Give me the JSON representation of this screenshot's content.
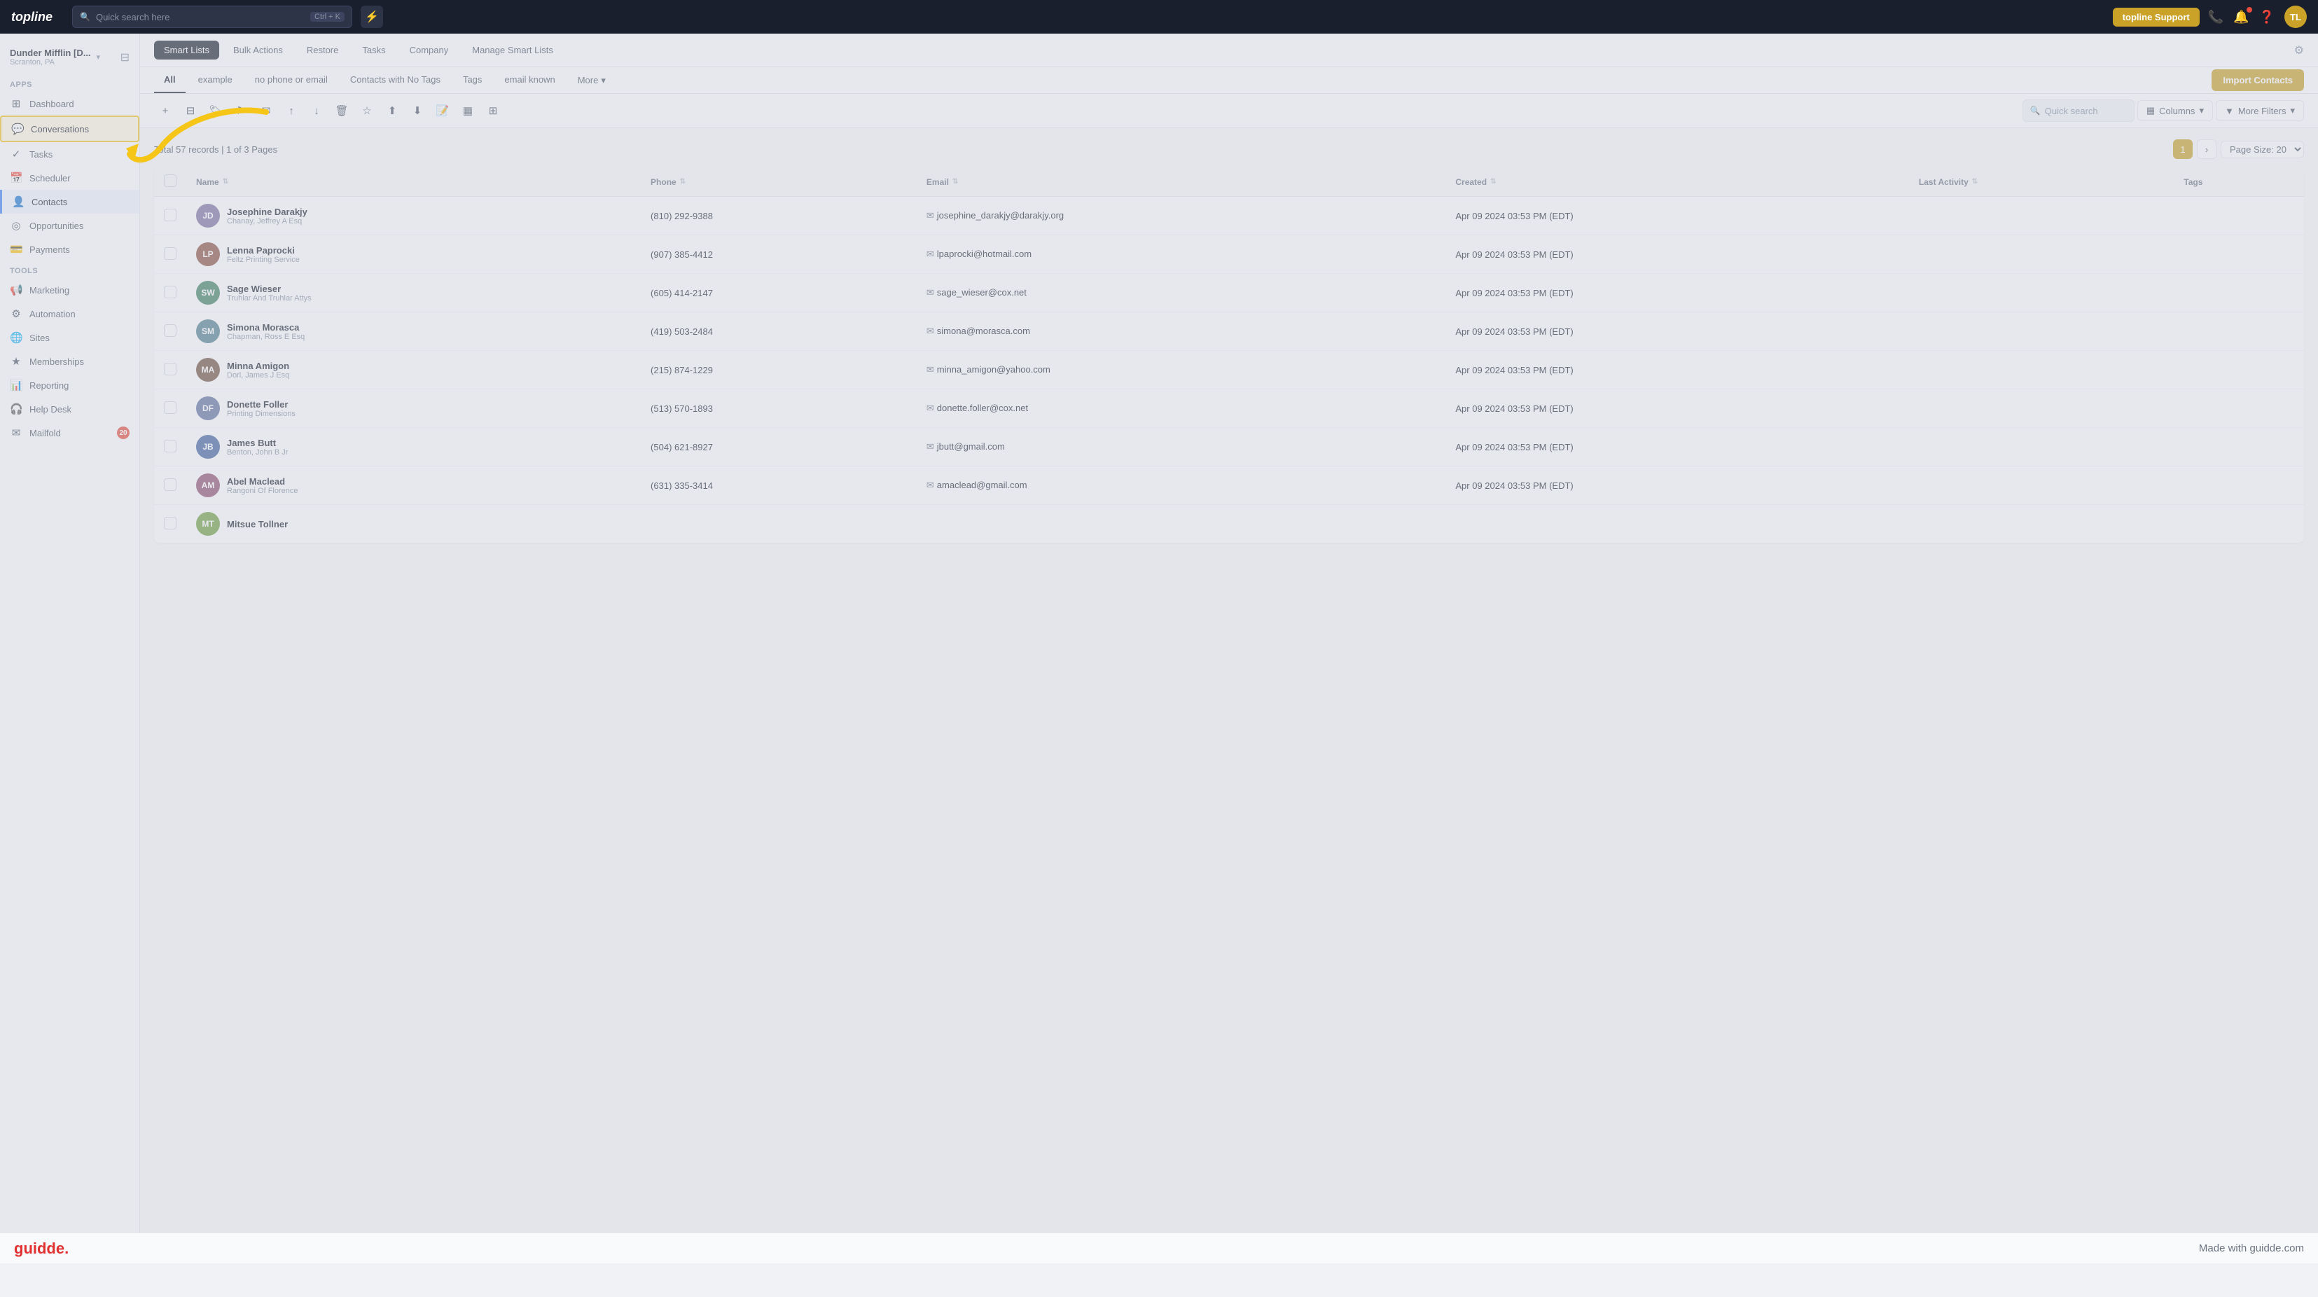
{
  "topnav": {
    "logo": "topline",
    "search_placeholder": "Quick search here",
    "search_shortcut": "Ctrl + K",
    "lightning_icon": "⚡",
    "support_btn": "topline Support",
    "phone_icon": "📞",
    "bell_icon": "🔔",
    "help_icon": "?",
    "avatar_initials": "TL"
  },
  "sidebar": {
    "workspace_name": "Dunder Mifflin [D...",
    "workspace_sub": "Scranton, PA",
    "section_apps": "Apps",
    "section_tools": "Tools",
    "items": [
      {
        "id": "dashboard",
        "label": "Dashboard",
        "icon": "⊞"
      },
      {
        "id": "conversations",
        "label": "Conversations",
        "icon": "💬",
        "active": true,
        "highlighted": true
      },
      {
        "id": "tasks",
        "label": "Tasks",
        "icon": "✓"
      },
      {
        "id": "scheduler",
        "label": "Scheduler",
        "icon": "📅"
      },
      {
        "id": "contacts",
        "label": "Contacts",
        "icon": "👤"
      },
      {
        "id": "opportunities",
        "label": "Opportunities",
        "icon": "◎"
      },
      {
        "id": "payments",
        "label": "Payments",
        "icon": "💳"
      },
      {
        "id": "marketing",
        "label": "Marketing",
        "icon": "📢"
      },
      {
        "id": "automation",
        "label": "Automation",
        "icon": "⚙"
      },
      {
        "id": "sites",
        "label": "Sites",
        "icon": "🌐"
      },
      {
        "id": "memberships",
        "label": "Memberships",
        "icon": "★"
      },
      {
        "id": "reporting",
        "label": "Reporting",
        "icon": "📊"
      },
      {
        "id": "helpdesk",
        "label": "Help Desk",
        "icon": "🎧"
      },
      {
        "id": "mailfold",
        "label": "Mailfold",
        "icon": "✉"
      }
    ]
  },
  "subheader": {
    "tabs": [
      {
        "id": "smart-lists",
        "label": "Smart Lists",
        "active": true
      },
      {
        "id": "bulk-actions",
        "label": "Bulk Actions"
      },
      {
        "id": "restore",
        "label": "Restore"
      },
      {
        "id": "tasks",
        "label": "Tasks"
      },
      {
        "id": "company",
        "label": "Company"
      },
      {
        "id": "manage-smart-lists",
        "label": "Manage Smart Lists"
      }
    ]
  },
  "filter_tabs": [
    {
      "id": "all",
      "label": "All",
      "active": true
    },
    {
      "id": "example",
      "label": "example"
    },
    {
      "id": "no-phone-email",
      "label": "no phone or email"
    },
    {
      "id": "contacts-no-tags",
      "label": "Contacts with No Tags"
    },
    {
      "id": "tags",
      "label": "Tags"
    },
    {
      "id": "email-known",
      "label": "email known"
    },
    {
      "id": "more",
      "label": "More",
      "has_dropdown": true
    }
  ],
  "import_btn": "Import Contacts",
  "toolbar": {
    "tools": [
      {
        "id": "add",
        "icon": "+"
      },
      {
        "id": "filter",
        "icon": "⊟"
      },
      {
        "id": "tag",
        "icon": "🏷"
      },
      {
        "id": "flag",
        "icon": "⚑"
      },
      {
        "id": "email",
        "icon": "✉"
      },
      {
        "id": "upload",
        "icon": "↑"
      },
      {
        "id": "download-inbox",
        "icon": "↓"
      },
      {
        "id": "trash",
        "icon": "🗑"
      },
      {
        "id": "star",
        "icon": "☆"
      },
      {
        "id": "export",
        "icon": "⬆"
      },
      {
        "id": "import",
        "icon": "⬇"
      },
      {
        "id": "note",
        "icon": "📝"
      },
      {
        "id": "columns-view",
        "icon": "▦"
      },
      {
        "id": "merge",
        "icon": "⊞"
      }
    ],
    "search_placeholder": "Quick search",
    "columns_btn": "Columns",
    "more_filters_btn": "More Filters"
  },
  "table": {
    "meta": "Total 57 records | 1 of 3 Pages",
    "pagination": {
      "current_page": 1,
      "next_btn": "›",
      "page_size_label": "Page Size: 20"
    },
    "columns": [
      {
        "id": "name",
        "label": "Name"
      },
      {
        "id": "phone",
        "label": "Phone"
      },
      {
        "id": "email",
        "label": "Email"
      },
      {
        "id": "created",
        "label": "Created"
      },
      {
        "id": "last-activity",
        "label": "Last Activity"
      },
      {
        "id": "tags",
        "label": "Tags"
      }
    ],
    "rows": [
      {
        "id": "1",
        "initials": "JD",
        "avatar_color": "#7c6f9f",
        "name": "Josephine Darakjy",
        "company": "Chanay, Jeffrey A Esq",
        "phone": "(810) 292-9388",
        "email": "josephine_darakjy@darakjy.org",
        "created": "Apr 09 2024 03:53 PM (EDT)",
        "last_activity": "",
        "tags": ""
      },
      {
        "id": "2",
        "initials": "LP",
        "avatar_color": "#8b4f3f",
        "name": "Lenna Paprocki",
        "company": "Feltz Printing Service",
        "phone": "(907) 385-4412",
        "email": "lpaprocki@hotmail.com",
        "created": "Apr 09 2024 03:53 PM (EDT)",
        "last_activity": "",
        "tags": ""
      },
      {
        "id": "3",
        "initials": "SW",
        "avatar_color": "#3f7f5f",
        "name": "Sage Wieser",
        "company": "Truhlar And Truhlar Attys",
        "phone": "(605) 414-2147",
        "email": "sage_wieser@cox.net",
        "created": "Apr 09 2024 03:53 PM (EDT)",
        "last_activity": "",
        "tags": ""
      },
      {
        "id": "4",
        "initials": "SM",
        "avatar_color": "#4f7f8f",
        "name": "Simona Morasca",
        "company": "Chapman, Ross E Esq",
        "phone": "(419) 503-2484",
        "email": "simona@morasca.com",
        "created": "Apr 09 2024 03:53 PM (EDT)",
        "last_activity": "",
        "tags": ""
      },
      {
        "id": "5",
        "initials": "MA",
        "avatar_color": "#6f4f3f",
        "name": "Minna Amigon",
        "company": "Dorl, James J Esq",
        "phone": "(215) 874-1229",
        "email": "minna_amigon@yahoo.com",
        "created": "Apr 09 2024 03:53 PM (EDT)",
        "last_activity": "",
        "tags": ""
      },
      {
        "id": "6",
        "initials": "DF",
        "avatar_color": "#5f6f9f",
        "name": "Donette Foller",
        "company": "Printing Dimensions",
        "phone": "(513) 570-1893",
        "email": "donette.foller@cox.net",
        "created": "Apr 09 2024 03:53 PM (EDT)",
        "last_activity": "",
        "tags": ""
      },
      {
        "id": "7",
        "initials": "JB",
        "avatar_color": "#3f5f9f",
        "name": "James Butt",
        "company": "Benton, John B Jr",
        "phone": "(504) 621-8927",
        "email": "jbutt@gmail.com",
        "created": "Apr 09 2024 03:53 PM (EDT)",
        "last_activity": "",
        "tags": ""
      },
      {
        "id": "8",
        "initials": "AM",
        "avatar_color": "#8f4f6f",
        "name": "Abel Maclead",
        "company": "Rangoni Of Florence",
        "phone": "(631) 335-3414",
        "email": "amaclead@gmail.com",
        "created": "Apr 09 2024 03:53 PM (EDT)",
        "last_activity": "",
        "tags": ""
      },
      {
        "id": "9",
        "initials": "MT",
        "avatar_color": "#6f9f3f",
        "name": "Mitsue Tollner",
        "company": "",
        "phone": "",
        "email": "",
        "created": "",
        "last_activity": "",
        "tags": ""
      }
    ]
  },
  "footer": {
    "logo": "guidde.",
    "tagline": "Made with guidde.com"
  },
  "arrow": {
    "color": "#f5c518"
  }
}
